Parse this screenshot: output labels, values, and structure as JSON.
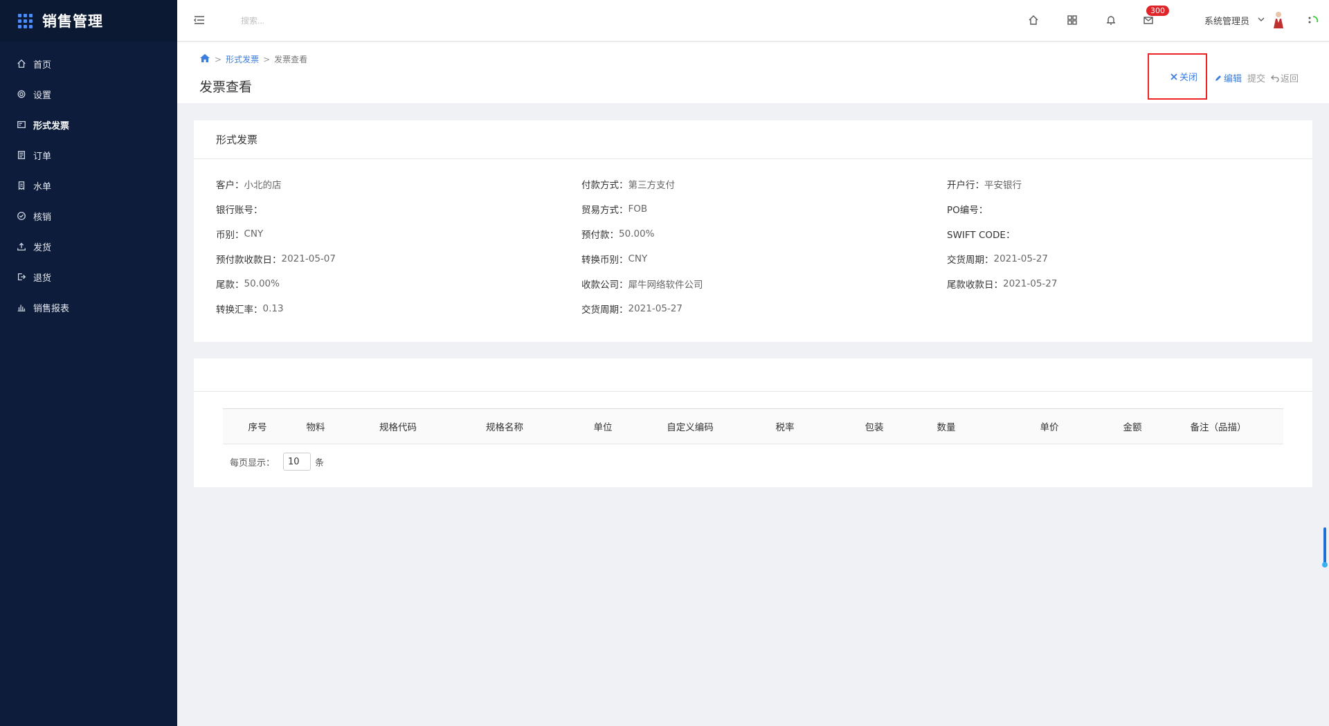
{
  "brand": {
    "title": "销售管理"
  },
  "sidebar": {
    "items": [
      {
        "label": "首页",
        "icon": "home-icon"
      },
      {
        "label": "设置",
        "icon": "gear-icon"
      },
      {
        "label": "形式发票",
        "icon": "invoice-icon",
        "active": true
      },
      {
        "label": "订单",
        "icon": "clipboard-icon"
      },
      {
        "label": "水单",
        "icon": "receipt-icon"
      },
      {
        "label": "核销",
        "icon": "check-circle-icon"
      },
      {
        "label": "发货",
        "icon": "upload-icon"
      },
      {
        "label": "退货",
        "icon": "return-icon"
      },
      {
        "label": "销售报表",
        "icon": "bar-chart-icon"
      }
    ]
  },
  "header": {
    "search_placeholder": "搜索...",
    "badge_count": "300",
    "user_name": "系统管理员"
  },
  "breadcrumb": {
    "level1": "形式发票",
    "level2": "发票查看"
  },
  "page": {
    "title": "发票查看"
  },
  "actions": {
    "close": "关闭",
    "edit": "编辑",
    "submit": "提交",
    "back": "返回"
  },
  "invoice": {
    "card_title": "形式发票",
    "fields": [
      {
        "label": "客户：",
        "value": "小北的店"
      },
      {
        "label": "付款方式：",
        "value": "第三方支付"
      },
      {
        "label": "开户行：",
        "value": "平安银行"
      },
      {
        "label": "银行账号：",
        "value": ""
      },
      {
        "label": "贸易方式：",
        "value": "FOB"
      },
      {
        "label": "PO编号：",
        "value": ""
      },
      {
        "label": "币别：",
        "value": "CNY"
      },
      {
        "label": "预付款：",
        "value": "50.00%"
      },
      {
        "label": "SWIFT CODE：",
        "value": ""
      },
      {
        "label": "预付款收款日：",
        "value": "2021-05-07"
      },
      {
        "label": "转换币别：",
        "value": "CNY"
      },
      {
        "label": "交货周期：",
        "value": "2021-05-27"
      },
      {
        "label": "尾款：",
        "value": "50.00%"
      },
      {
        "label": "收款公司：",
        "value": "犀牛网络软件公司"
      },
      {
        "label": "尾款收款日：",
        "value": "2021-05-27"
      },
      {
        "label": "转换汇率：",
        "value": "0.13"
      },
      {
        "label": "交货周期：",
        "value": "2021-05-27"
      }
    ]
  },
  "table": {
    "columns": [
      "序号",
      "物料",
      "规格代码",
      "规格名称",
      "单位",
      "自定义编码",
      "税率",
      "包装",
      "数量",
      "单价",
      "金额",
      "备注（品描）"
    ]
  },
  "pager": {
    "label": "每页显示：",
    "page_size": "10",
    "unit": "条"
  }
}
